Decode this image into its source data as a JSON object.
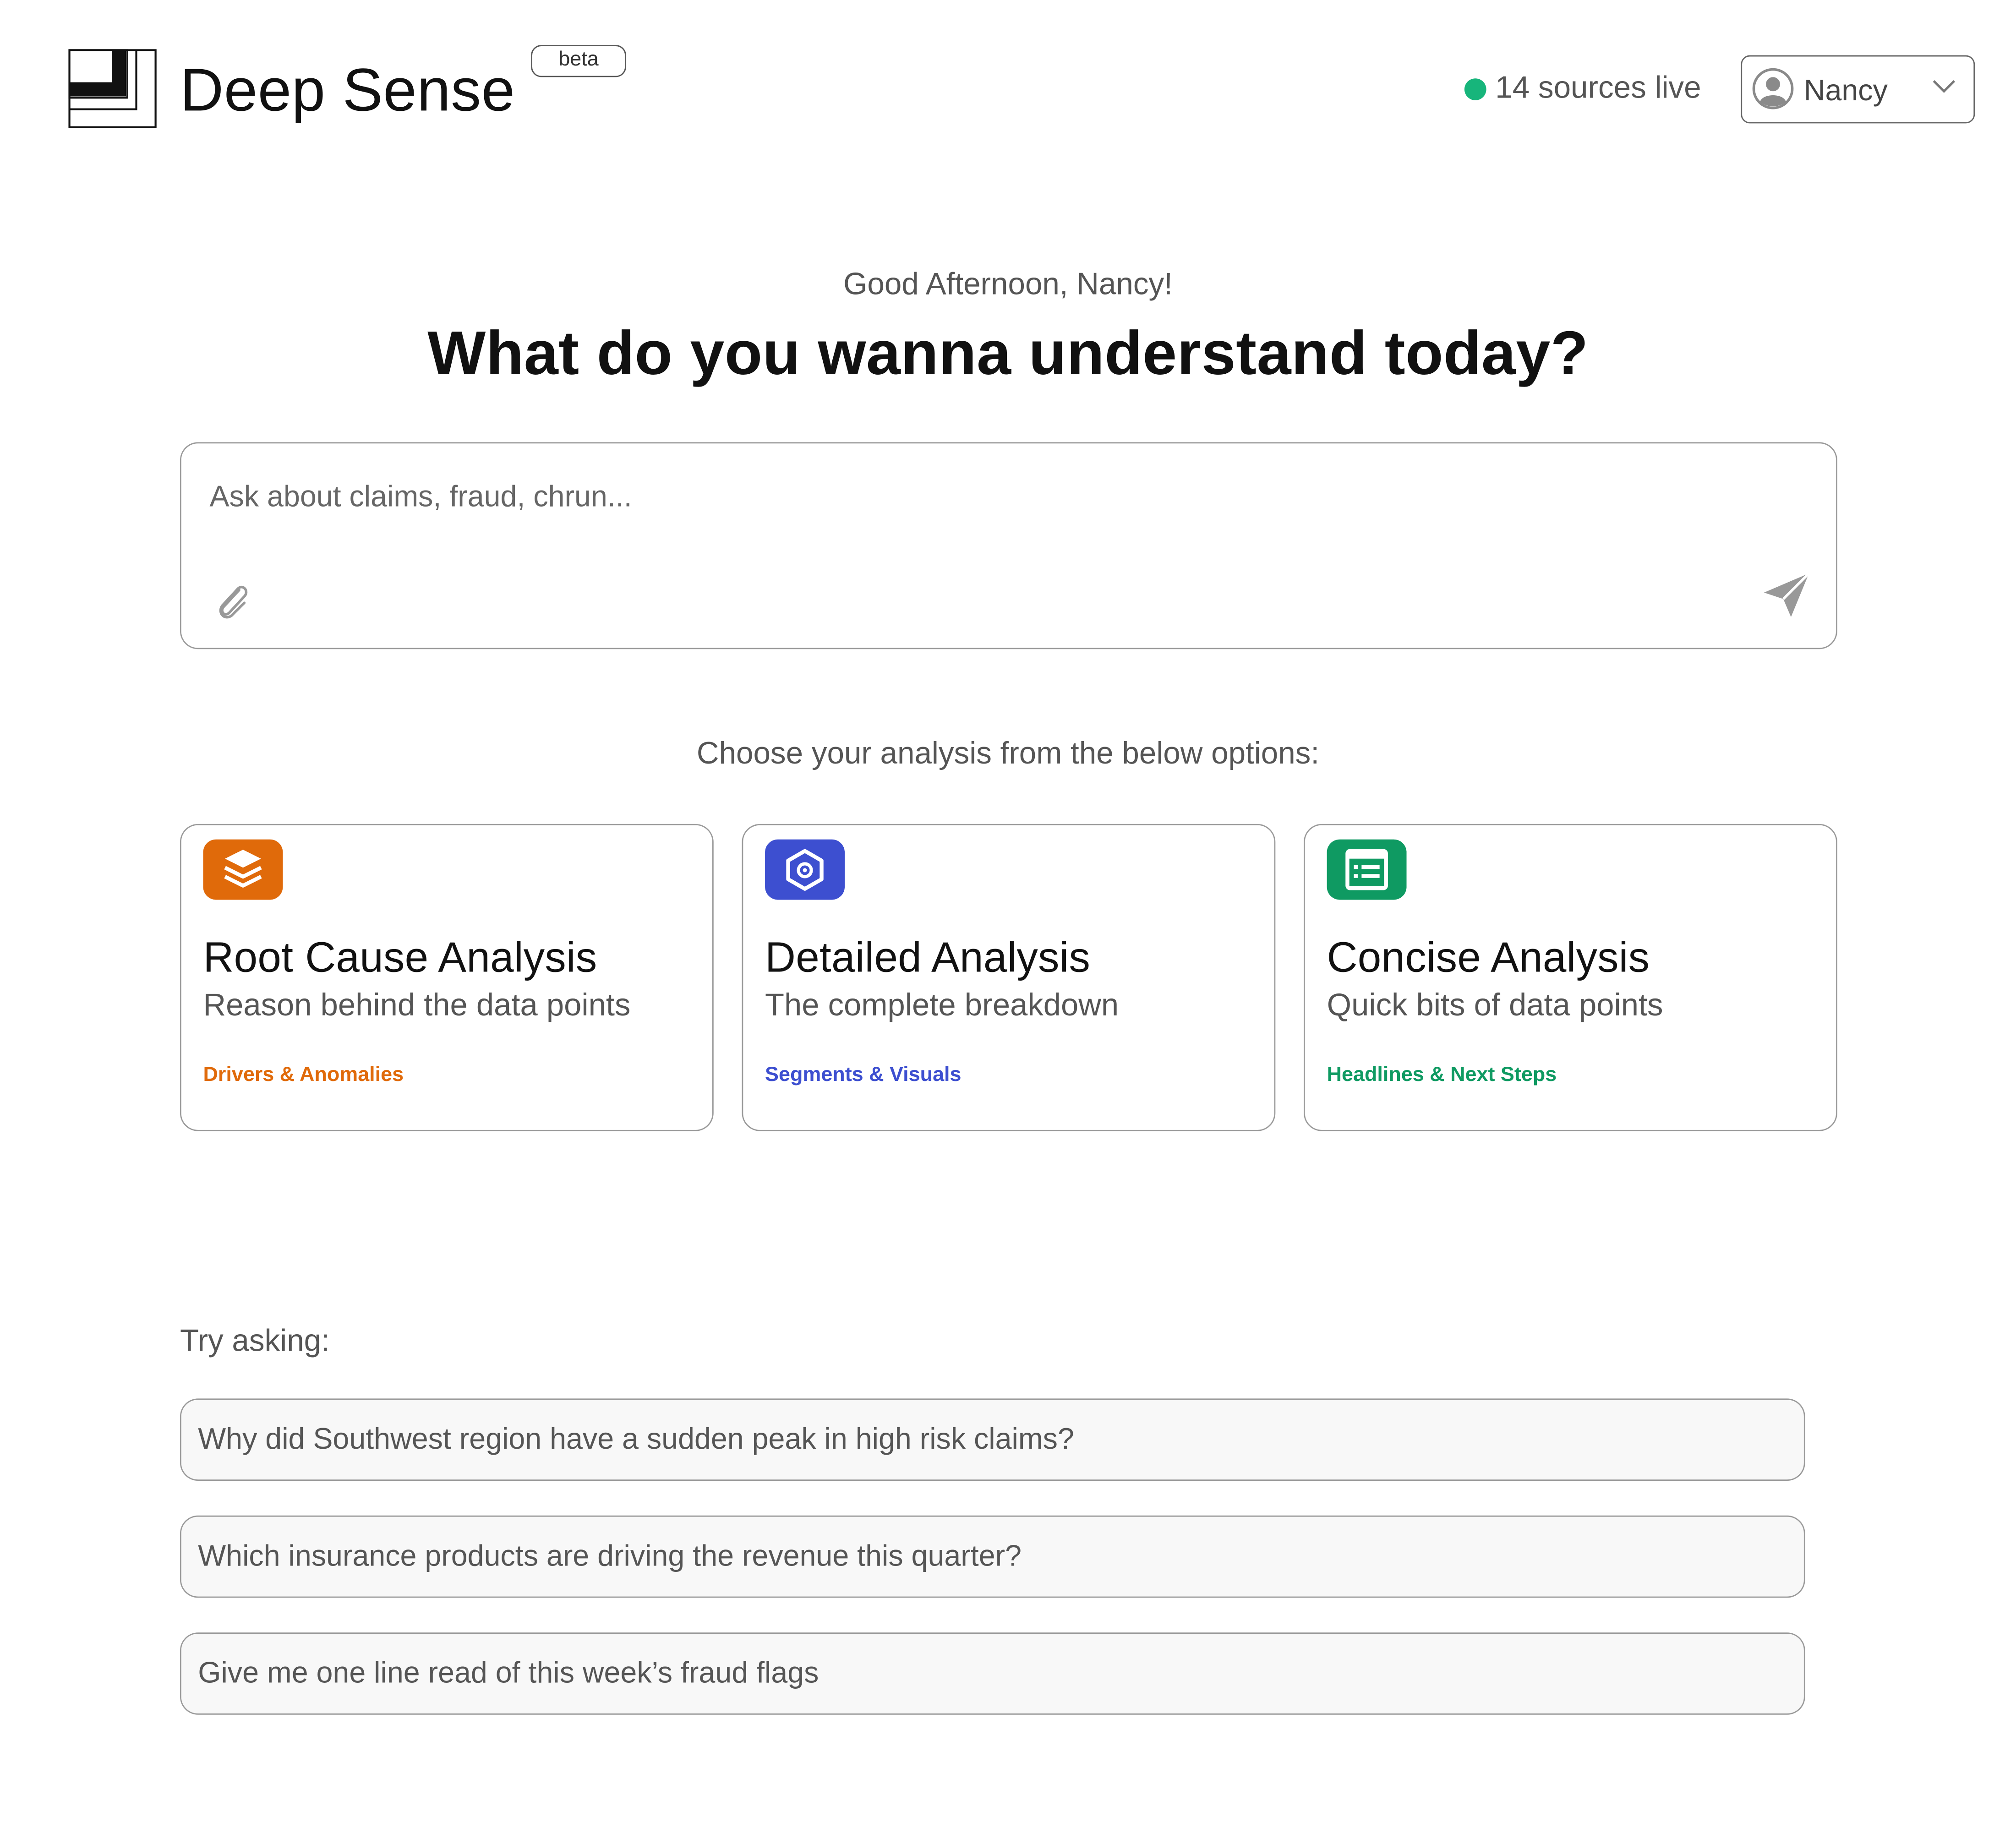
{
  "header": {
    "app_title": "Deep Sense",
    "badge": "beta",
    "status": {
      "text": "14 sources live",
      "dot_color": "#17b57b"
    },
    "user_menu": {
      "name": "Nancy",
      "avatar_icon": "user-avatar-icon",
      "chevron_icon": "chevron-down-icon"
    }
  },
  "hero": {
    "greeting": "Good Afternoon, Nancy!",
    "headline": "What do you wanna understand today?"
  },
  "ask_box": {
    "placeholder": "Ask about claims, fraud, chrun...",
    "value": "",
    "attach_icon": "paperclip-icon",
    "send_icon": "send-icon"
  },
  "analysis": {
    "prompt": "Choose your analysis from the below options:",
    "options": [
      {
        "title": "Root Cause Analysis",
        "subtitle": "Reason behind the data points",
        "tag": "Drivers & Anomalies",
        "icon": "layers-icon",
        "color": "#e06a0a"
      },
      {
        "title": "Detailed Analysis",
        "subtitle": "The complete breakdown",
        "tag": "Segments & Visuals",
        "icon": "cube-icon",
        "color": "#3d4fd0"
      },
      {
        "title": "Concise Analysis",
        "subtitle": "Quick bits of data points",
        "tag": "Headlines & Next Steps",
        "icon": "list-card-icon",
        "color": "#0f9a62"
      }
    ]
  },
  "suggestions": {
    "label": "Try asking:",
    "items": [
      "Why did Southwest region have a sudden peak in high risk claims?",
      "Which insurance products are driving the revenue this quarter?",
      "Give me one line read of this week’s fraud flags"
    ]
  }
}
